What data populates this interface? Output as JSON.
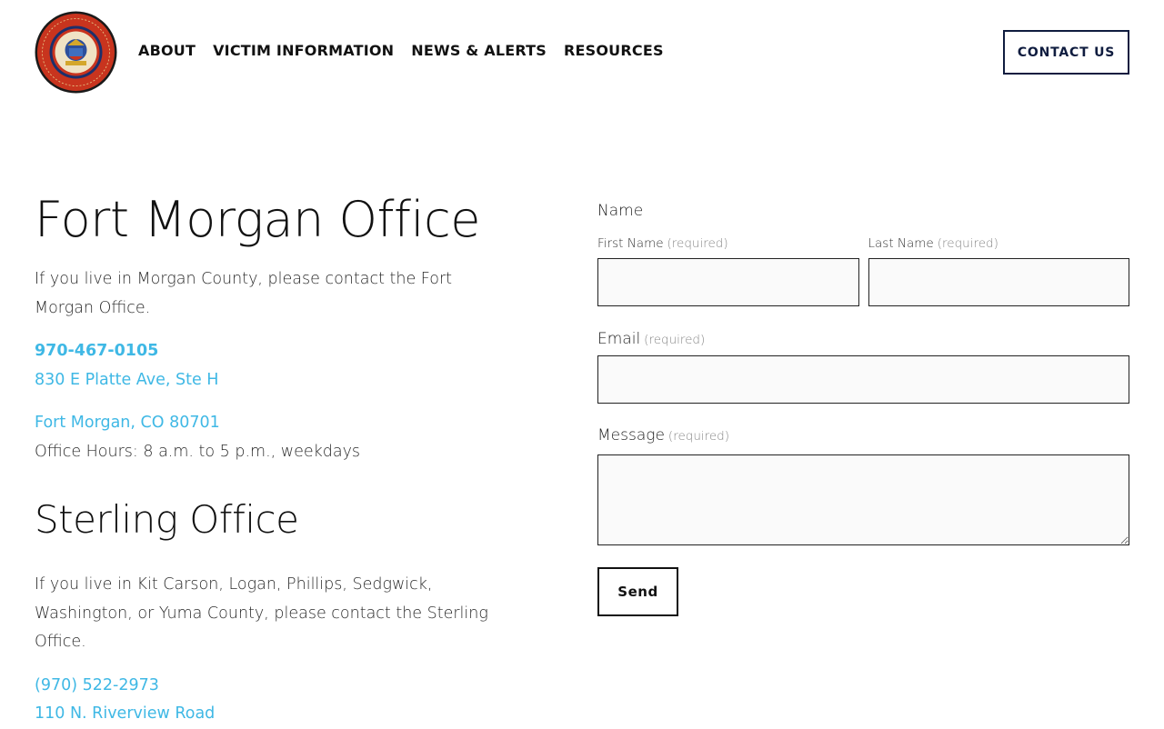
{
  "header": {
    "logo_text": [
      "District Attorney",
      "State of Colorado",
      "Thirteenth Judicial District"
    ],
    "nav": [
      "ABOUT",
      "VICTIM INFORMATION",
      "NEWS & ALERTS",
      "RESOURCES"
    ],
    "contact_label": "CONTACT US"
  },
  "fort_morgan": {
    "title": "Fort Morgan Office",
    "intro": "If you live in Morgan County, please contact the Fort Morgan Office.",
    "phone": "970-467-0105",
    "address1": "830 E Platte Ave, Ste H",
    "address2": "Fort Morgan, CO 80701",
    "hours": "Office Hours: 8 a.m. to 5 p.m., weekdays"
  },
  "sterling": {
    "title": "Sterling Office",
    "intro": "If you live in Kit Carson, Logan, Phillips, Sedgwick, Washington, or Yuma County, please contact the Sterling Office.",
    "phone": "(970) 522-2973",
    "address1": "110 N. Riverview Road"
  },
  "form": {
    "name_legend": "Name",
    "first_name_label": "First Name",
    "last_name_label": "Last Name",
    "email_label": "Email",
    "message_label": "Message",
    "required_text": "(required)",
    "send_label": "Send"
  },
  "colors": {
    "link": "#3fb8e5",
    "navy": "#0f1c3f"
  }
}
